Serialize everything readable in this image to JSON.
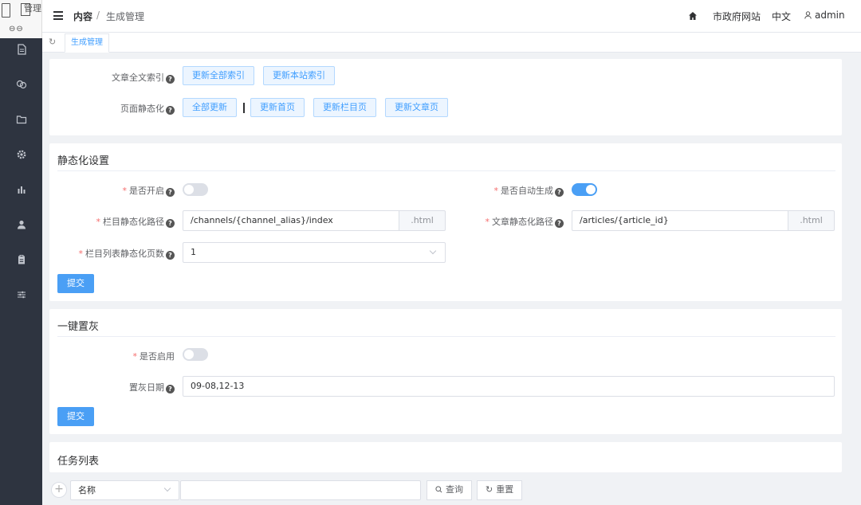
{
  "sidebar": {
    "logo_text": "管理",
    "icons": [
      "document-icon",
      "link-icon",
      "folder-icon",
      "gear-icon",
      "bar-chart-icon",
      "user-icon",
      "clipboard-icon",
      "sliders-icon"
    ]
  },
  "header": {
    "crumb_root": "内容",
    "crumb_sep": "/",
    "crumb_current": "生成管理",
    "site_link": "市政府网站",
    "language": "中文",
    "user": "admin"
  },
  "tabs": [
    {
      "label": "生成管理",
      "active": true
    }
  ],
  "index_section": {
    "fulltext_label": "文章全文索引",
    "btn_update_all_index": "更新全部索引",
    "btn_update_site_index": "更新本站索引",
    "static_label": "页面静态化",
    "btn_all": "全部更新",
    "separator": "|",
    "btn_home": "更新首页",
    "btn_channel": "更新栏目页",
    "btn_article": "更新文章页"
  },
  "static_settings": {
    "title": "静态化设置",
    "enable_label": "是否开启",
    "enable_value": false,
    "auto_label": "是否自动生成",
    "auto_value": true,
    "channel_path_label": "栏目静态化路径",
    "channel_path_value": "/channels/{channel_alias}/index",
    "channel_path_suffix": ".html",
    "article_path_label": "文章静态化路径",
    "article_path_value": "/articles/{article_id}",
    "article_path_suffix": ".html",
    "pages_label": "栏目列表静态化页数",
    "pages_value": "1",
    "submit": "提交"
  },
  "gray_section": {
    "title": "一键置灰",
    "enable_label": "是否启用",
    "enable_value": false,
    "dates_label": "置灰日期",
    "dates_value": "09-08,12-13",
    "submit": "提交"
  },
  "task_list": {
    "title": "任务列表",
    "filter_field": "名称",
    "filter_value": "",
    "search_btn": "查询",
    "reset_btn": "重置"
  },
  "colors": {
    "primary": "#409eff",
    "sidebar": "#2e3440",
    "required": "#f56c6c"
  }
}
